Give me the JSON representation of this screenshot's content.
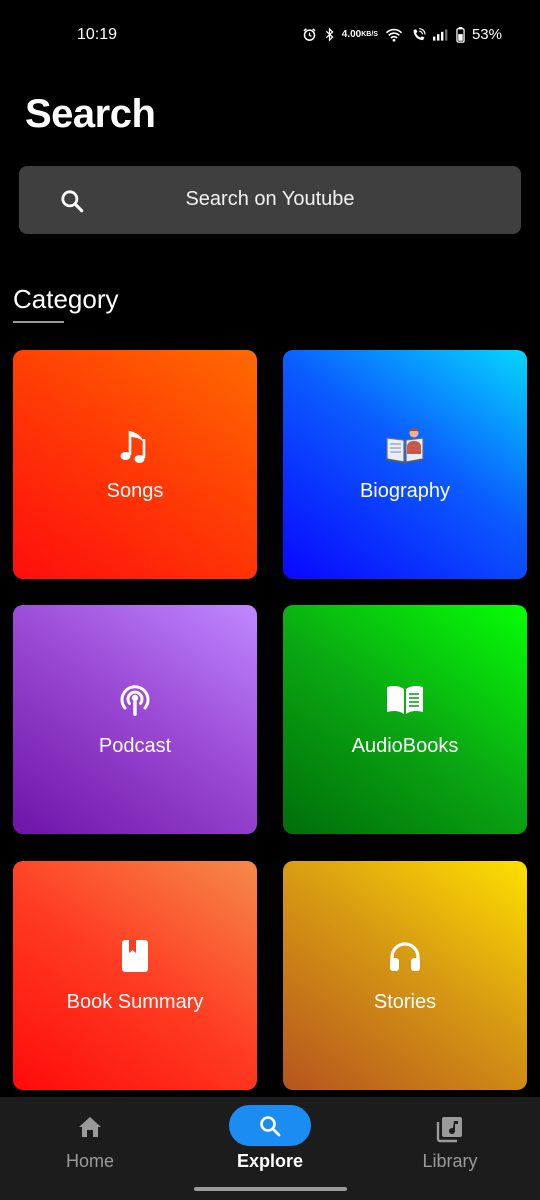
{
  "status_bar": {
    "time": "10:19",
    "net_speed_value": "4.00",
    "net_speed_unit": "KB/S",
    "battery": "53%",
    "icons": [
      "alarm-icon",
      "bluetooth-icon",
      "wifi-icon",
      "wifi-calling-icon",
      "signal-icon",
      "battery-icon"
    ]
  },
  "header": {
    "title": "Search"
  },
  "search": {
    "placeholder": "Search on Youtube",
    "icon": "search-icon"
  },
  "category": {
    "title": "Category",
    "tiles": [
      {
        "label": "Songs",
        "icon": "music-note-icon",
        "colors": [
          "#ff0d0d",
          "#ff6a00"
        ]
      },
      {
        "label": "Biography",
        "icon": "open-book-reader-icon",
        "colors": [
          "#0a06ff",
          "#06d6ff"
        ]
      },
      {
        "label": "Podcast",
        "icon": "podcast-icon",
        "colors": [
          "#6e14a8",
          "#c088ff"
        ]
      },
      {
        "label": "AudioBooks",
        "icon": "open-book-icon",
        "colors": [
          "#006e0a",
          "#06ff06"
        ]
      },
      {
        "label": "Book Summary",
        "icon": "bookmark-book-icon",
        "colors": [
          "#ff0a0a",
          "#f58a4a"
        ]
      },
      {
        "label": "Stories",
        "icon": "headphones-icon",
        "colors": [
          "#b5541e",
          "#ffe000"
        ]
      }
    ]
  },
  "bottom_nav": {
    "items": [
      {
        "label": "Home",
        "icon": "home-icon",
        "active": false
      },
      {
        "label": "Explore",
        "icon": "search-icon",
        "active": true
      },
      {
        "label": "Library",
        "icon": "library-music-icon",
        "active": false
      }
    ],
    "active_color": "#1a8cf2"
  }
}
